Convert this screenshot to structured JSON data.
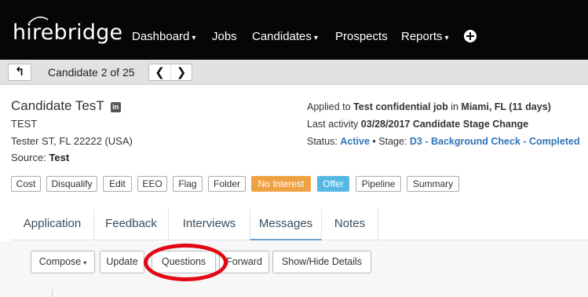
{
  "app": {
    "logo_text": "hirebridge",
    "nav": [
      {
        "label": "Dashboard",
        "dropdown": true
      },
      {
        "label": "Jobs",
        "dropdown": false
      },
      {
        "label": "Candidates",
        "dropdown": true
      },
      {
        "label": "Prospects",
        "dropdown": false
      },
      {
        "label": "Reports",
        "dropdown": true
      }
    ],
    "caret_glyph": "▾",
    "add_icon": "plus-circle-icon"
  },
  "candidate_bar": {
    "back_glyph": "↰",
    "position_text": "Candidate 2 of 25",
    "prev_glyph": "❮",
    "next_glyph": "❯"
  },
  "candidate": {
    "name": "Candidate TesT",
    "linkedin_glyph": "in",
    "title": "TEST",
    "address": "Tester ST, FL 22222 (USA)",
    "source_label": "Source:",
    "source_value": "Test"
  },
  "application": {
    "applied_prefix": "Applied to",
    "job": "Test confidential job",
    "in_text": "in",
    "location": "Miami, FL (11 days)",
    "activity_label": "Last activity",
    "activity_value": "03/28/2017 Candidate Stage Change",
    "status_label": "Status:",
    "status_value": "Active",
    "stage_sep": "• Stage:",
    "stage_value": "D3 - Background Check - Completed",
    "colors": {
      "link": "#2f73b7"
    }
  },
  "actions": [
    {
      "label": "Cost",
      "style": "default"
    },
    {
      "label": "Disqualify",
      "style": "default"
    },
    {
      "label": "Edit",
      "style": "default"
    },
    {
      "label": "EEO",
      "style": "default"
    },
    {
      "label": "Flag",
      "style": "default"
    },
    {
      "label": "Folder",
      "style": "default"
    },
    {
      "label": "No Interest",
      "style": "orange"
    },
    {
      "label": "Offer",
      "style": "teal"
    },
    {
      "label": "Pipeline",
      "style": "default"
    },
    {
      "label": "Summary",
      "style": "default"
    }
  ],
  "action_colors": {
    "orange": "#f0a141",
    "teal": "#55b8e3"
  },
  "tabs": [
    {
      "label": "Application",
      "active": false
    },
    {
      "label": "Feedback",
      "active": false
    },
    {
      "label": "Interviews",
      "active": false
    },
    {
      "label": "Messages",
      "active": true
    },
    {
      "label": "Notes",
      "active": false
    }
  ],
  "message_toolbar": {
    "compose": "Compose",
    "update": "Update",
    "questions": "Questions",
    "forward": "Forward",
    "show_hide": "Show/Hide Details",
    "highlight_color": "#e30613"
  }
}
